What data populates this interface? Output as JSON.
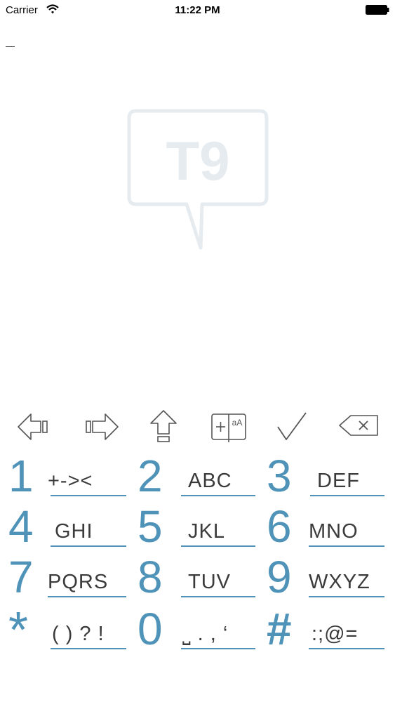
{
  "status_bar": {
    "carrier": "Carrier",
    "time": "11:22 PM",
    "wifi_icon": "wifi-icon",
    "battery_icon": "battery-icon"
  },
  "logo": {
    "text": "T9",
    "color": "#e6ebf0"
  },
  "toolbar": {
    "icons": [
      "arrow-left-icon",
      "arrow-right-icon",
      "shift-icon",
      "add-word-icon",
      "checkmark-icon",
      "backspace-icon"
    ],
    "add_word_letters": "aA"
  },
  "keypad": {
    "accent_color": "#4f93b9",
    "keys": [
      {
        "num": "1",
        "letters": "+->&lt;"
      },
      {
        "num": "2",
        "letters": "ABC"
      },
      {
        "num": "3",
        "letters": "DEF"
      },
      {
        "num": "4",
        "letters": "GHI"
      },
      {
        "num": "5",
        "letters": "JKL"
      },
      {
        "num": "6",
        "letters": "MNO"
      },
      {
        "num": "7",
        "letters": "PQRS"
      },
      {
        "num": "8",
        "letters": "TUV"
      },
      {
        "num": "9",
        "letters": "WXYZ"
      },
      {
        "num": "*",
        "letters": "( ) ? !"
      },
      {
        "num": "0",
        "letters": "⎵ . , ‘"
      },
      {
        "num": "#",
        "letters": ":;@="
      }
    ]
  }
}
